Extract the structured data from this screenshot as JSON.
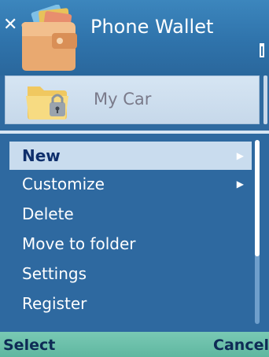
{
  "app": {
    "title": "Phone Wallet"
  },
  "folder": {
    "name": "My Car"
  },
  "menu": {
    "items": [
      {
        "label": "New",
        "has_submenu": true,
        "selected": true
      },
      {
        "label": "Customize",
        "has_submenu": true,
        "selected": false
      },
      {
        "label": "Delete",
        "has_submenu": false,
        "selected": false
      },
      {
        "label": "Move to folder",
        "has_submenu": false,
        "selected": false
      },
      {
        "label": "Settings",
        "has_submenu": false,
        "selected": false
      },
      {
        "label": "Register",
        "has_submenu": false,
        "selected": false
      }
    ],
    "submenu_arrow": "▶"
  },
  "softkeys": {
    "left": "Select",
    "right": "Cancel"
  },
  "icons": {
    "close": "close-icon",
    "app": "wallet-icon",
    "folder": "locked-folder-icon",
    "battery": "battery-icon"
  },
  "colors": {
    "background": "#2f6aa0",
    "highlight": "#c9dcee",
    "softkey_bar": "#6cc0aa"
  }
}
